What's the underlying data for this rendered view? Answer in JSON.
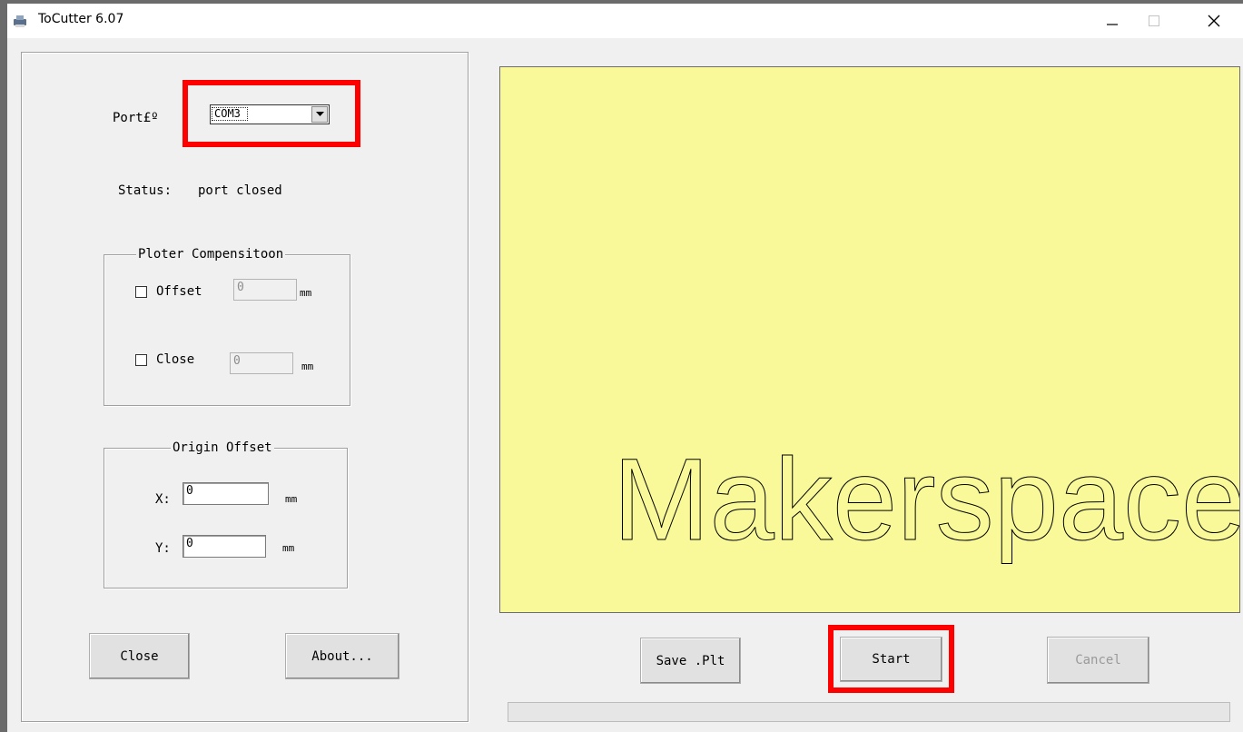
{
  "window": {
    "title": "ToCutter 6.07"
  },
  "left_panel": {
    "port_label": "Port£º",
    "port_value": "COM3",
    "status_label": "Status:",
    "status_value": "port closed",
    "ploter_group": {
      "title": "Ploter Compensitoon",
      "offset_label": "Offset",
      "offset_value": "0",
      "offset_unit": "mm",
      "close_label": "Close",
      "close_value": "0",
      "close_unit": "mm"
    },
    "origin_group": {
      "title": "Origin Offset",
      "x_label": "X:",
      "x_value": "0",
      "x_unit": "mm",
      "y_label": "Y:",
      "y_value": "0",
      "y_unit": "mm"
    },
    "close_button": "Close",
    "about_button": "About..."
  },
  "preview": {
    "text": "Makerspace",
    "background": "#f9f99a"
  },
  "bottom_bar": {
    "save_button": "Save .Plt",
    "start_button": "Start",
    "cancel_button": "Cancel"
  },
  "highlights": {
    "color": "#ff0000"
  }
}
